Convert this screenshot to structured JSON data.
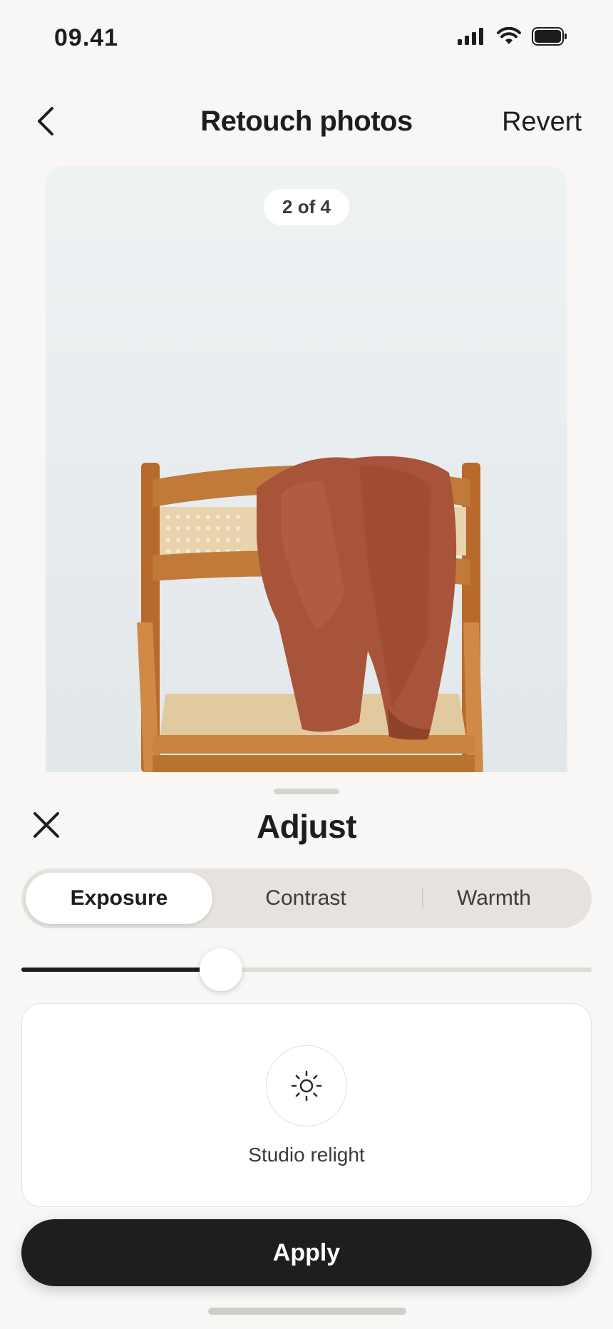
{
  "status_bar": {
    "time": "09.41",
    "icons": [
      "cellular-signal-icon",
      "wifi-icon",
      "battery-icon"
    ]
  },
  "nav": {
    "back_icon": "chevron-left-icon",
    "title": "Retouch photos",
    "revert_label": "Revert"
  },
  "photo": {
    "counter": "2 of 4"
  },
  "sheet": {
    "close_icon": "close-icon",
    "title": "Adjust",
    "tabs": [
      {
        "label": "Exposure",
        "active": true
      },
      {
        "label": "Contrast",
        "active": false
      },
      {
        "label": "Warmth",
        "active": false
      }
    ],
    "slider_value_fraction": 0.35,
    "relight": {
      "icon": "sun-icon",
      "label": "Studio relight"
    },
    "apply_label": "Apply"
  },
  "colors": {
    "background": "#f8f7f5",
    "primary_button": "#1e1e1c",
    "sweater": "#a8543a",
    "chair_wood": "#c07a3a"
  }
}
